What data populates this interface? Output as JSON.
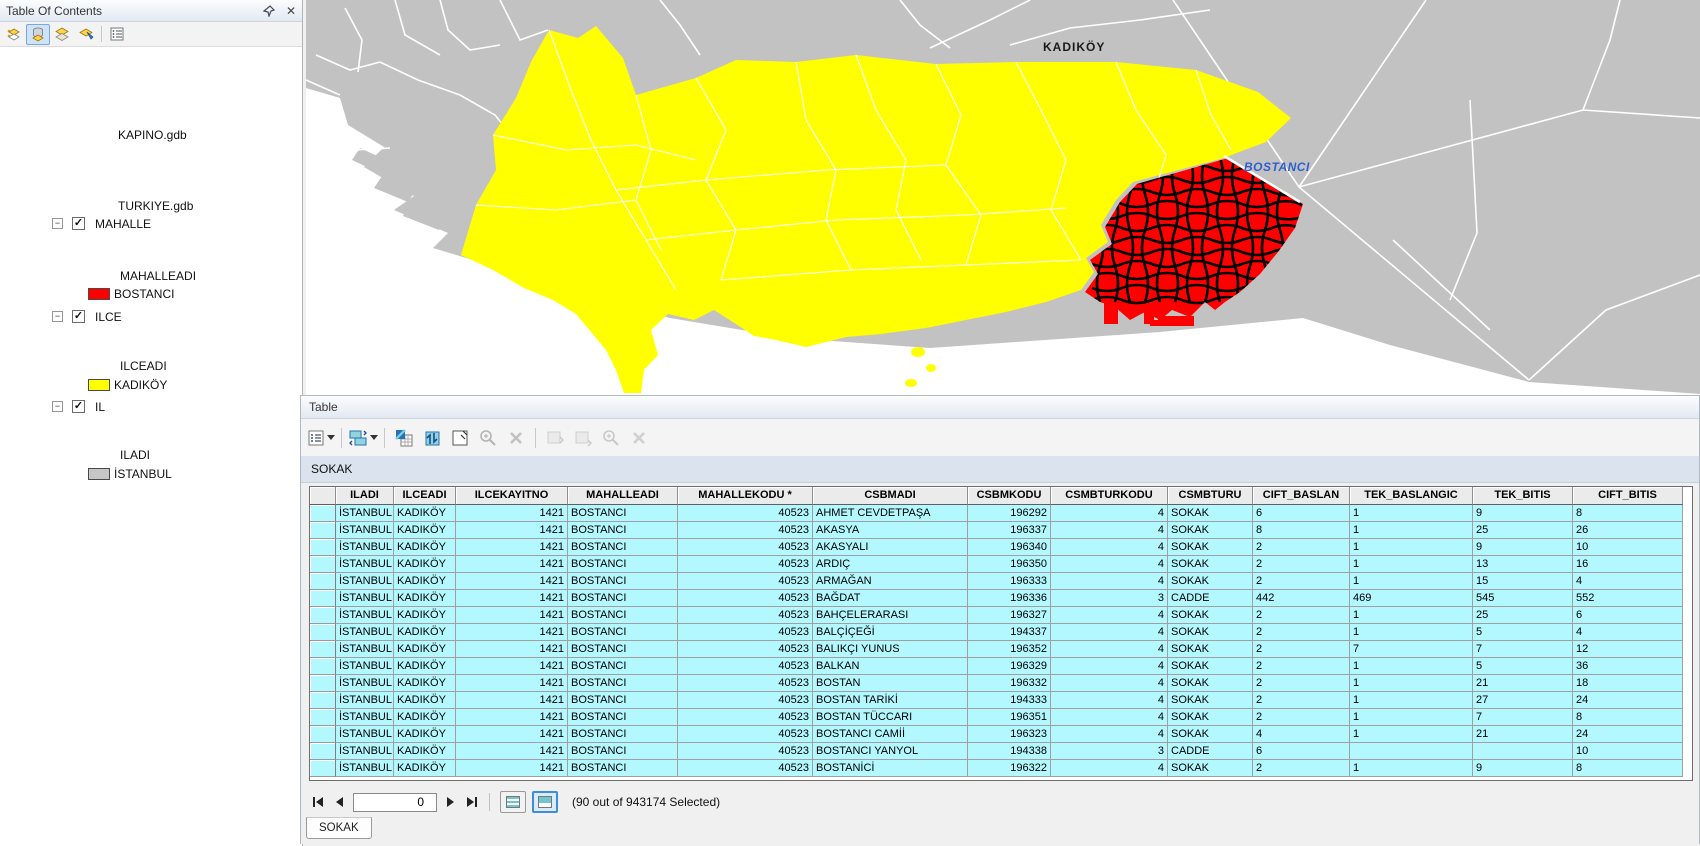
{
  "toc": {
    "title": "Table Of Contents",
    "items": [
      {
        "kind": "source",
        "label": "KAPINO.gdb"
      },
      {
        "kind": "source",
        "label": "TURKIYE.gdb"
      },
      {
        "kind": "layer",
        "label": "MAHALLE",
        "checked": true
      },
      {
        "kind": "field",
        "label": "MAHALLEADI"
      },
      {
        "kind": "legend",
        "label": "BOSTANCI",
        "swatch": "#ff0000"
      },
      {
        "kind": "layer",
        "label": "ILCE",
        "checked": true
      },
      {
        "kind": "field",
        "label": "ILCEADI"
      },
      {
        "kind": "legend",
        "label": "KADIKÖY",
        "swatch": "#ffff00"
      },
      {
        "kind": "layer",
        "label": "IL",
        "checked": true
      },
      {
        "kind": "field",
        "label": "ILADI"
      },
      {
        "kind": "legend",
        "label": "İSTANBUL",
        "swatch": "#c6c6c6"
      }
    ]
  },
  "map": {
    "labels": {
      "district": "KADIKÖY",
      "neighborhood": "BOSTANCI"
    },
    "colors": {
      "land": "#c2c2c2",
      "sea": "#ffffff",
      "district_fill": "#ffff00",
      "selection_fill": "#ff0000",
      "streets": "#000000",
      "boundary": "#ffffff",
      "label_blue": "#2e5fce"
    }
  },
  "table": {
    "title": "Table",
    "layer_name": "SOKAK",
    "tab": "SOKAK",
    "columns": [
      "ILADI",
      "ILCEADI",
      "ILCEKAYITNO",
      "MAHALLEADI",
      "MAHALLEKODU *",
      "CSBMADI",
      "CSBMKODU",
      "CSMBTURKODU",
      "CSMBTURU",
      "CIFT_BASLAN",
      "TEK_BASLANGIC",
      "TEK_BITIS",
      "CIFT_BITIS"
    ],
    "rows": [
      [
        "İSTANBUL",
        "KADIKÖY",
        "1421",
        "BOSTANCI",
        "40523",
        "AHMET CEVDETPAŞA",
        "196292",
        "4",
        "SOKAK",
        "6",
        "1",
        "9",
        "8"
      ],
      [
        "İSTANBUL",
        "KADIKÖY",
        "1421",
        "BOSTANCI",
        "40523",
        "AKASYA",
        "196337",
        "4",
        "SOKAK",
        "8",
        "1",
        "25",
        "26"
      ],
      [
        "İSTANBUL",
        "KADIKÖY",
        "1421",
        "BOSTANCI",
        "40523",
        "AKASYALI",
        "196340",
        "4",
        "SOKAK",
        "2",
        "1",
        "9",
        "10"
      ],
      [
        "İSTANBUL",
        "KADIKÖY",
        "1421",
        "BOSTANCI",
        "40523",
        "ARDIÇ",
        "196350",
        "4",
        "SOKAK",
        "2",
        "1",
        "13",
        "16"
      ],
      [
        "İSTANBUL",
        "KADIKÖY",
        "1421",
        "BOSTANCI",
        "40523",
        "ARMAĞAN",
        "196333",
        "4",
        "SOKAK",
        "2",
        "1",
        "15",
        "4"
      ],
      [
        "İSTANBUL",
        "KADIKÖY",
        "1421",
        "BOSTANCI",
        "40523",
        "BAĞDAT",
        "196336",
        "3",
        "CADDE",
        "442",
        "469",
        "545",
        "552"
      ],
      [
        "İSTANBUL",
        "KADIKÖY",
        "1421",
        "BOSTANCI",
        "40523",
        "BAHÇELERARASI",
        "196327",
        "4",
        "SOKAK",
        "2",
        "1",
        "25",
        "6"
      ],
      [
        "İSTANBUL",
        "KADIKÖY",
        "1421",
        "BOSTANCI",
        "40523",
        "BALÇİÇEĞİ",
        "194337",
        "4",
        "SOKAK",
        "2",
        "1",
        "5",
        "4"
      ],
      [
        "İSTANBUL",
        "KADIKÖY",
        "1421",
        "BOSTANCI",
        "40523",
        "BALIKÇI YUNUS",
        "196352",
        "4",
        "SOKAK",
        "2",
        "7",
        "7",
        "12"
      ],
      [
        "İSTANBUL",
        "KADIKÖY",
        "1421",
        "BOSTANCI",
        "40523",
        "BALKAN",
        "196329",
        "4",
        "SOKAK",
        "2",
        "1",
        "5",
        "36"
      ],
      [
        "İSTANBUL",
        "KADIKÖY",
        "1421",
        "BOSTANCI",
        "40523",
        "BOSTAN",
        "196332",
        "4",
        "SOKAK",
        "2",
        "1",
        "21",
        "18"
      ],
      [
        "İSTANBUL",
        "KADIKÖY",
        "1421",
        "BOSTANCI",
        "40523",
        "BOSTAN TARİKİ",
        "194333",
        "4",
        "SOKAK",
        "2",
        "1",
        "27",
        "24"
      ],
      [
        "İSTANBUL",
        "KADIKÖY",
        "1421",
        "BOSTANCI",
        "40523",
        "BOSTAN TÜCCARI",
        "196351",
        "4",
        "SOKAK",
        "2",
        "1",
        "7",
        "8"
      ],
      [
        "İSTANBUL",
        "KADIKÖY",
        "1421",
        "BOSTANCI",
        "40523",
        "BOSTANCI CAMİİ",
        "196323",
        "4",
        "SOKAK",
        "4",
        "1",
        "21",
        "24"
      ],
      [
        "İSTANBUL",
        "KADIKÖY",
        "1421",
        "BOSTANCI",
        "40523",
        "BOSTANCI YANYOL",
        "194338",
        "3",
        "CADDE",
        "6",
        "",
        "",
        "10"
      ],
      [
        "İSTANBUL",
        "KADIKÖY",
        "1421",
        "BOSTANCI",
        "40523",
        "BOSTANİCİ",
        "196322",
        "4",
        "SOKAK",
        "2",
        "1",
        "9",
        "8"
      ]
    ],
    "nav": {
      "record_value": "0",
      "status": "(90 out of 943174 Selected)"
    }
  }
}
